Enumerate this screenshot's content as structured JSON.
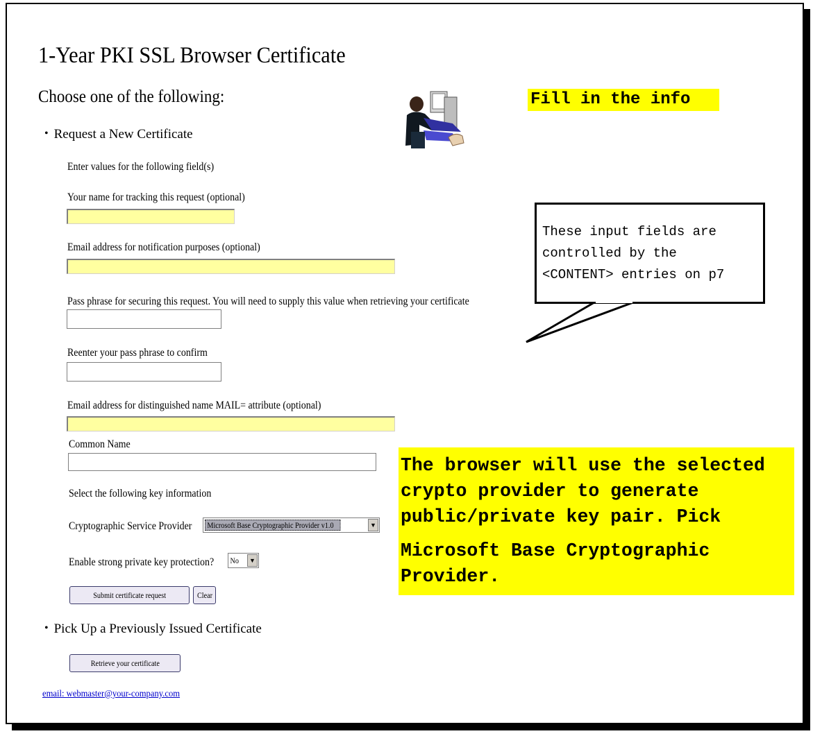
{
  "page": {
    "title": "1-Year PKI SSL Browser Certificate",
    "choose_heading": "Choose one of the following:"
  },
  "request_section": {
    "heading": "Request a New Certificate",
    "intro": "Enter values for the following field(s)",
    "fields": {
      "tracking_name_label": "Your name for tracking this request (optional)",
      "tracking_name_value": "",
      "notify_email_label": "Email address for notification purposes (optional)",
      "notify_email_value": "",
      "pass_phrase_label": "Pass phrase for securing this request. You will need to supply this value when retrieving your certificate",
      "pass_phrase_value": "",
      "pass_phrase_confirm_label": "Reenter your pass phrase to confirm",
      "pass_phrase_confirm_value": "",
      "dn_email_label": "Email address for distinguished name MAIL= attribute (optional)",
      "dn_email_value": "",
      "common_name_label": "Common Name",
      "common_name_value": ""
    },
    "key_info_label": "Select the following key information",
    "csp_label": "Cryptographic Service Provider",
    "csp_selected": "Microsoft Base Cryptographic Provider v1.0",
    "strong_protection_label": "Enable strong private key protection?",
    "strong_protection_selected": "No",
    "submit_button": "Submit certificate request",
    "clear_button": "Clear"
  },
  "pickup_section": {
    "heading": "Pick Up a Previously Issued Certificate",
    "retrieve_button": "Retrieve your certificate"
  },
  "footer": {
    "email_link": "email: webmaster@your-company.com"
  },
  "annotations": {
    "fill_in": "Fill in the info",
    "callout_lines": [
      "These input fields are",
      "controlled by the",
      "<CONTENT> entries on p7"
    ],
    "provider_note_lines": [
      "The browser will use the selected",
      "crypto provider to generate",
      "public/private key pair. Pick",
      "Microsoft Base Cryptographic",
      "Provider."
    ]
  },
  "colors": {
    "highlight_field": "#ffffa0",
    "note_highlight": "#ffff00",
    "link": "#0000cc"
  },
  "icons": {
    "illustration": "person-at-computer-icon"
  }
}
